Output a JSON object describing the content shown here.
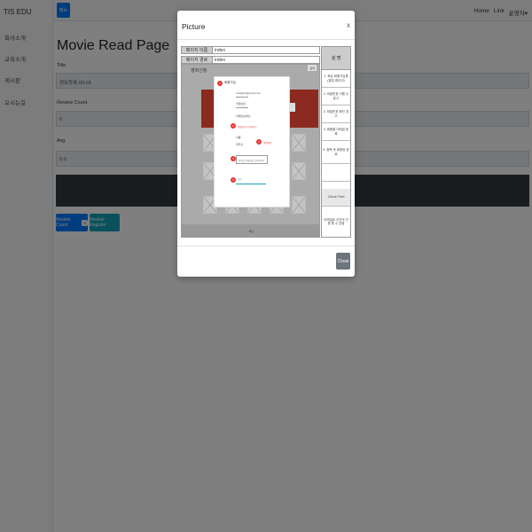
{
  "brand": "TIS EDU",
  "sidebar": {
    "items": [
      {
        "label": "회사소개"
      },
      {
        "label": "교육소개"
      },
      {
        "label": "게시판"
      },
      {
        "label": "오시는길"
      }
    ]
  },
  "topbar": {
    "menu_label": "메뉴",
    "links": [
      "Home",
      "Link",
      "운영자▾"
    ]
  },
  "main": {
    "page_title": "Movie Read Page",
    "fields": [
      {
        "label": "Title",
        "value": "정보등록 00:18"
      },
      {
        "label": "Review Count",
        "value": "0"
      },
      {
        "label": "Avg",
        "value": "0.0"
      }
    ],
    "review_count_button": "Review Count",
    "review_count_badge": "0",
    "review_register_button": "Review Register"
  },
  "modal": {
    "title": "Picture",
    "close_x": "x",
    "close_button": "Close",
    "picture": {
      "rows": [
        {
          "label": "페이지 이름",
          "value": "index"
        },
        {
          "label": "페이지 경로",
          "value": "index"
        }
      ],
      "desc_header": "설 명",
      "desc_items": [
        "1. 최상 회원가입폼 (팝업 레이어)",
        "2. 비밀번호 이름 수 표고",
        "3. 비밀번호 확인 표고",
        "4. 회원을 이메일 등록",
        "5. 중복 후 회원등 완료",
        "",
        "Check Point",
        "이메일로 이전의 인증 폼 수 있음"
      ],
      "canvas_title": "영화신청",
      "canvas_search": "검색",
      "popup_title": "회원가입",
      "popup_email": "ccw@tis@gmail.com",
      "popup_password_label": "비밀번호",
      "popup_password_confirm": "비밀번호확인",
      "popup_error_text": "비밀번호가 일치하지",
      "popup_name_label": "이름",
      "popup_name_value": "정학선",
      "popup_name_check": "중복확인",
      "popup_input_placeholder": "인증할 이메일을 입력하세요",
      "popup_submit": "가입",
      "footer": "하단"
    }
  }
}
